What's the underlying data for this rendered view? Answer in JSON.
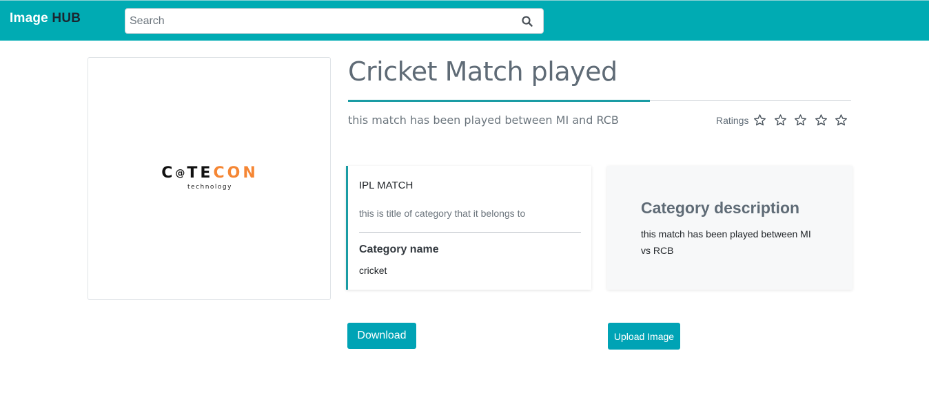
{
  "navbar": {
    "brand_prefix": "Image",
    "brand_suffix": "HUB",
    "search": {
      "placeholder": "Search",
      "value": "",
      "icon": "search-icon"
    }
  },
  "image": {
    "logo_main_1": "C",
    "logo_at": "@",
    "logo_main_2": "TE",
    "logo_main_orange": "CON",
    "logo_sub": "technology"
  },
  "detail": {
    "title": "Cricket Match played",
    "subtitle": "this match has been played between MI and RCB",
    "ratings": {
      "label": "Ratings",
      "value": 0,
      "max": 5,
      "icon": "star-outline-icon"
    }
  },
  "info_card": {
    "title": "IPL MATCH",
    "description": "this is title of category that it belongs to",
    "category_label": "Category name",
    "category_value": "cricket"
  },
  "description_card": {
    "title": "Category description",
    "text": "this match has been played between MI vs RCB"
  },
  "actions": {
    "download_label": "Download",
    "upload_label": "Upload Image"
  },
  "colors": {
    "navbar": "#00abb3",
    "accent": "#1a9ca4",
    "button": "#00a3b5",
    "logo_orange": "#f58634"
  }
}
